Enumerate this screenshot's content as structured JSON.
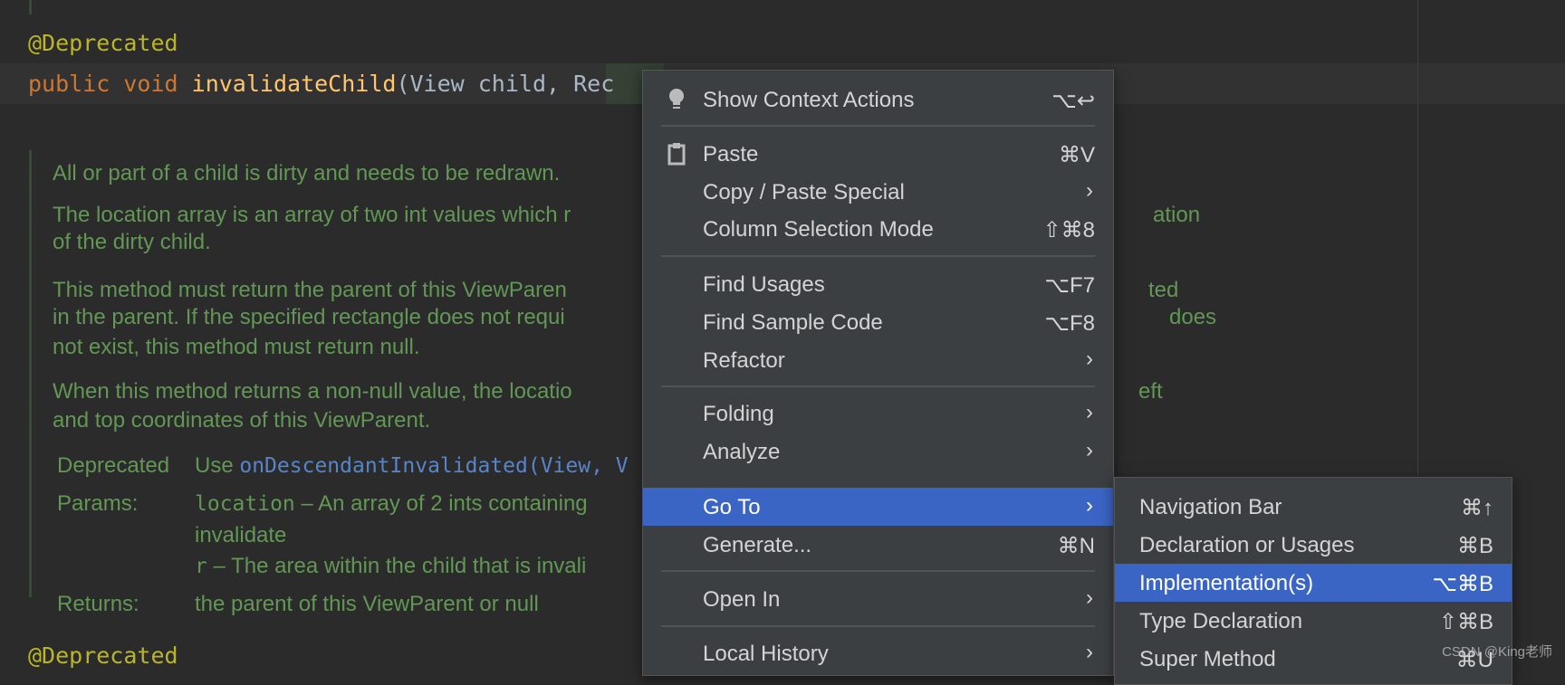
{
  "editor": {
    "annotation1": "@Deprecated",
    "sig": {
      "kw1": "public",
      "kw2": "void",
      "method": "invalidateChild",
      "params": "(View child, ",
      "param_hl": "Rec"
    },
    "doc": {
      "p1": "All or part of a child is dirty and needs to be redrawn.",
      "p2a": "The location array is an array of two int values which r",
      "p2a_tail": "ation",
      "p2b": "of the dirty child.",
      "p3a": "This method must return the parent of this ViewParen",
      "p3a_tail": "ted",
      "p3b": "in the parent. If the specified rectangle does not requi",
      "p3b_tail": "does",
      "p3c": "not exist, this method must return null.",
      "p4a": "When this method returns a non-null value, the locatio",
      "p4a_tail": "eft",
      "p4b": "and top coordinates of this ViewParent.",
      "deprecated_label": "Deprecated",
      "deprecated_use": "Use",
      "deprecated_link": "onDescendantInvalidated(View, V",
      "params_label": "Params:",
      "param1_name": "location",
      "param1_desc": " – An array of 2 ints containing",
      "param1_cont": "invalidate",
      "param2_name": "r",
      "param2_desc": " – The area within the child that is invali",
      "returns_label": "Returns:",
      "returns_value": "the parent of this ViewParent or null"
    },
    "annotation2": "@Deprecated"
  },
  "context_menu": {
    "items": [
      {
        "label": "Show Context Actions",
        "shortcut": "⌥↩",
        "icon": "lightbulb-icon"
      },
      {
        "label": "Paste",
        "shortcut": "⌘V",
        "icon": "clipboard-icon"
      },
      {
        "label": "Copy / Paste Special",
        "submenu": true
      },
      {
        "label": "Column Selection Mode",
        "shortcut": "⇧⌘8"
      },
      {
        "label": "Find Usages",
        "shortcut": "⌥F7"
      },
      {
        "label": "Find Sample Code",
        "shortcut": "⌥F8"
      },
      {
        "label": "Refactor",
        "submenu": true
      },
      {
        "label": "Folding",
        "submenu": true
      },
      {
        "label": "Analyze",
        "submenu": true
      },
      {
        "label": "Go To",
        "submenu": true,
        "selected": true
      },
      {
        "label": "Generate...",
        "shortcut": "⌘N"
      },
      {
        "label": "Open In",
        "submenu": true
      },
      {
        "label": "Local History",
        "submenu": true
      }
    ]
  },
  "goto_submenu": {
    "items": [
      {
        "label": "Navigation Bar",
        "shortcut": "⌘↑"
      },
      {
        "label": "Declaration or Usages",
        "shortcut": "⌘B"
      },
      {
        "label": "Implementation(s)",
        "shortcut": "⌥⌘B",
        "selected": true
      },
      {
        "label": "Type Declaration",
        "shortcut": "⇧⌘B"
      },
      {
        "label": "Super Method",
        "shortcut": "⌘U"
      }
    ]
  },
  "arrow_glyph": "›",
  "watermark": "CSDN @King老师",
  "colors": {
    "background": "#2b2b2b",
    "menu": "#3c3f41",
    "selection": "#3b65c4",
    "doc_text": "#629755",
    "annotation": "#bbb529",
    "keyword": "#cc7832",
    "method": "#ffc66d"
  }
}
